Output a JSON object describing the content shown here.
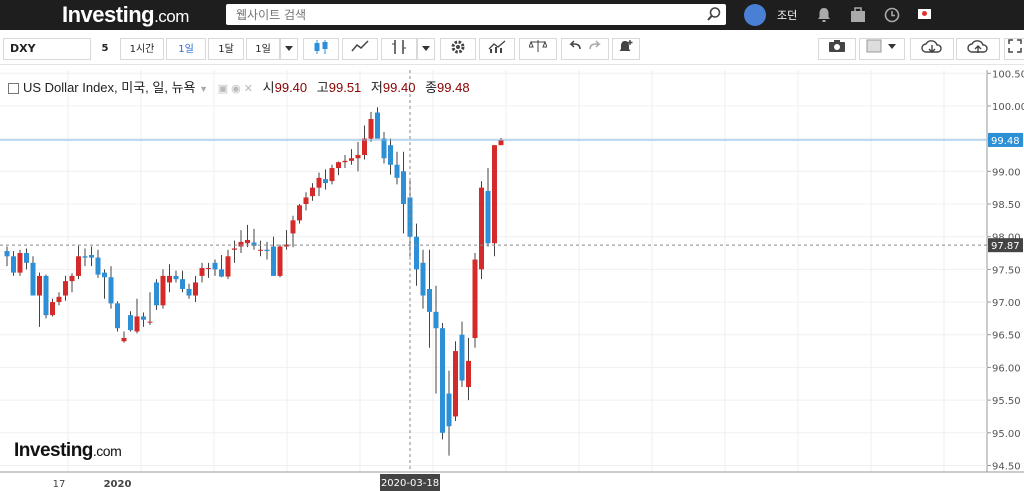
{
  "header": {
    "logo_main": "Investing",
    "logo_suffix": ".com",
    "search_placeholder": "웹사이트 검색",
    "username": "조던"
  },
  "toolbar": {
    "symbol": "DXY",
    "interval_count": "5",
    "intervals": [
      "1시간",
      "1일",
      "1달",
      "1일"
    ],
    "active_interval": "1일"
  },
  "legend": {
    "instrument": "US Dollar Index, 미국, 일, 뉴욕",
    "open_label": "시",
    "open": "99.40",
    "high_label": "고",
    "high": "99.51",
    "low_label": "저",
    "low": "99.40",
    "close_label": "종",
    "close": "99.48"
  },
  "watermark": {
    "main": "Investing",
    "suffix": ".com"
  },
  "colors": {
    "up": "#d42a2a",
    "down": "#2d8fd6",
    "wick": "#444444"
  },
  "chart_data": {
    "type": "candlestick",
    "title": "US Dollar Index, 미국, 일, 뉴욕",
    "ylim": [
      94.4,
      100.55
    ],
    "yticks": [
      "100.50",
      "100.00",
      "99.50",
      "99.00",
      "98.50",
      "98.00",
      "97.50",
      "97.00",
      "96.50",
      "96.00",
      "95.50",
      "95.00",
      "94.50"
    ],
    "xtick_labels": [
      {
        "label": "17",
        "index": 8
      },
      {
        "label": "2020",
        "index": 17
      }
    ],
    "crosshair_label": "2020-03-18",
    "crosshair_index": 62,
    "price_markers": [
      {
        "value": 99.48,
        "label": "99.48",
        "style": "current"
      },
      {
        "value": 97.87,
        "label": "97.87",
        "style": "crosshair"
      }
    ],
    "candles": [
      [
        97.78,
        97.85,
        97.55,
        97.7
      ],
      [
        97.7,
        97.78,
        97.4,
        97.45
      ],
      [
        97.45,
        97.8,
        97.4,
        97.75
      ],
      [
        97.75,
        97.82,
        97.5,
        97.6
      ],
      [
        97.6,
        97.7,
        97.15,
        97.1
      ],
      [
        97.1,
        97.45,
        96.62,
        97.4
      ],
      [
        97.4,
        97.42,
        96.75,
        96.8
      ],
      [
        96.8,
        97.05,
        96.78,
        97.0
      ],
      [
        97.0,
        97.15,
        96.95,
        97.08
      ],
      [
        97.1,
        97.4,
        97.02,
        97.32
      ],
      [
        97.32,
        97.44,
        97.15,
        97.4
      ],
      [
        97.4,
        97.86,
        97.35,
        97.7
      ],
      [
        97.7,
        97.82,
        97.55,
        97.68
      ],
      [
        97.72,
        97.85,
        97.55,
        97.68
      ],
      [
        97.68,
        97.8,
        97.37,
        97.42
      ],
      [
        97.45,
        97.5,
        97.05,
        97.38
      ],
      [
        97.38,
        97.55,
        96.9,
        96.98
      ],
      [
        96.98,
        97.01,
        96.55,
        96.6
      ],
      [
        96.4,
        96.55,
        96.38,
        96.45
      ],
      [
        96.8,
        96.86,
        96.55,
        96.57
      ],
      [
        96.55,
        97.05,
        96.52,
        96.78
      ],
      [
        96.78,
        96.84,
        96.62,
        96.73
      ],
      [
        96.7,
        97.15,
        96.65,
        96.7
      ],
      [
        97.3,
        97.35,
        96.88,
        96.95
      ],
      [
        96.95,
        97.5,
        96.9,
        97.4
      ],
      [
        97.3,
        97.58,
        97.15,
        97.4
      ],
      [
        97.4,
        97.48,
        97.3,
        97.35
      ],
      [
        97.35,
        97.48,
        97.15,
        97.2
      ],
      [
        97.2,
        97.28,
        97.05,
        97.1
      ],
      [
        97.1,
        97.4,
        97.0,
        97.3
      ],
      [
        97.4,
        97.6,
        97.3,
        97.52
      ],
      [
        97.52,
        97.6,
        97.37,
        97.52
      ],
      [
        97.6,
        97.65,
        97.4,
        97.5
      ],
      [
        97.5,
        97.72,
        97.38,
        97.39
      ],
      [
        97.39,
        97.8,
        97.35,
        97.7
      ],
      [
        97.8,
        97.94,
        97.6,
        97.82
      ],
      [
        97.85,
        98.1,
        97.75,
        97.92
      ],
      [
        97.9,
        98.18,
        97.84,
        97.95
      ],
      [
        97.91,
        98.12,
        97.8,
        97.86
      ],
      [
        97.8,
        97.94,
        97.7,
        97.8
      ],
      [
        97.8,
        97.92,
        97.65,
        97.78
      ],
      [
        97.85,
        98.0,
        97.4,
        97.4
      ],
      [
        97.4,
        97.88,
        97.38,
        97.85
      ],
      [
        97.85,
        98.1,
        97.8,
        97.88
      ],
      [
        98.05,
        98.32,
        97.84,
        98.25
      ],
      [
        98.25,
        98.5,
        98.2,
        98.48
      ],
      [
        98.5,
        98.68,
        98.4,
        98.6
      ],
      [
        98.62,
        98.82,
        98.55,
        98.75
      ],
      [
        98.75,
        98.98,
        98.62,
        98.9
      ],
      [
        98.88,
        99.03,
        98.72,
        98.82
      ],
      [
        98.85,
        99.1,
        98.8,
        99.05
      ],
      [
        99.05,
        99.15,
        98.94,
        99.14
      ],
      [
        99.14,
        99.25,
        99.05,
        99.16
      ],
      [
        99.16,
        99.34,
        99.1,
        99.2
      ],
      [
        99.2,
        99.45,
        99.0,
        99.25
      ],
      [
        99.25,
        99.7,
        99.18,
        99.5
      ],
      [
        99.5,
        99.91,
        99.45,
        99.8
      ],
      [
        99.9,
        99.98,
        99.75,
        99.5
      ],
      [
        99.5,
        99.6,
        99.12,
        99.2
      ],
      [
        99.4,
        99.5,
        98.95,
        99.1
      ],
      [
        99.1,
        99.3,
        98.8,
        98.9
      ],
      [
        99.0,
        99.3,
        98.05,
        98.5
      ],
      [
        98.6,
        98.88,
        97.65,
        98.0
      ],
      [
        98.0,
        98.2,
        97.25,
        97.5
      ],
      [
        97.6,
        97.8,
        96.9,
        97.1
      ],
      [
        97.2,
        97.8,
        96.3,
        96.85
      ],
      [
        96.85,
        97.25,
        95.6,
        96.6
      ],
      [
        96.6,
        96.68,
        94.9,
        95.0
      ],
      [
        95.6,
        95.95,
        94.65,
        95.1
      ],
      [
        95.25,
        96.4,
        95.18,
        96.25
      ],
      [
        96.5,
        96.7,
        95.7,
        95.8
      ],
      [
        95.7,
        96.45,
        95.5,
        96.1
      ],
      [
        96.45,
        97.75,
        96.3,
        97.65
      ],
      [
        97.5,
        98.85,
        97.35,
        98.75
      ],
      [
        98.7,
        99.05,
        97.85,
        97.9
      ],
      [
        97.9,
        99.4,
        97.7,
        99.4
      ],
      [
        99.4,
        99.51,
        99.4,
        99.48
      ]
    ]
  }
}
